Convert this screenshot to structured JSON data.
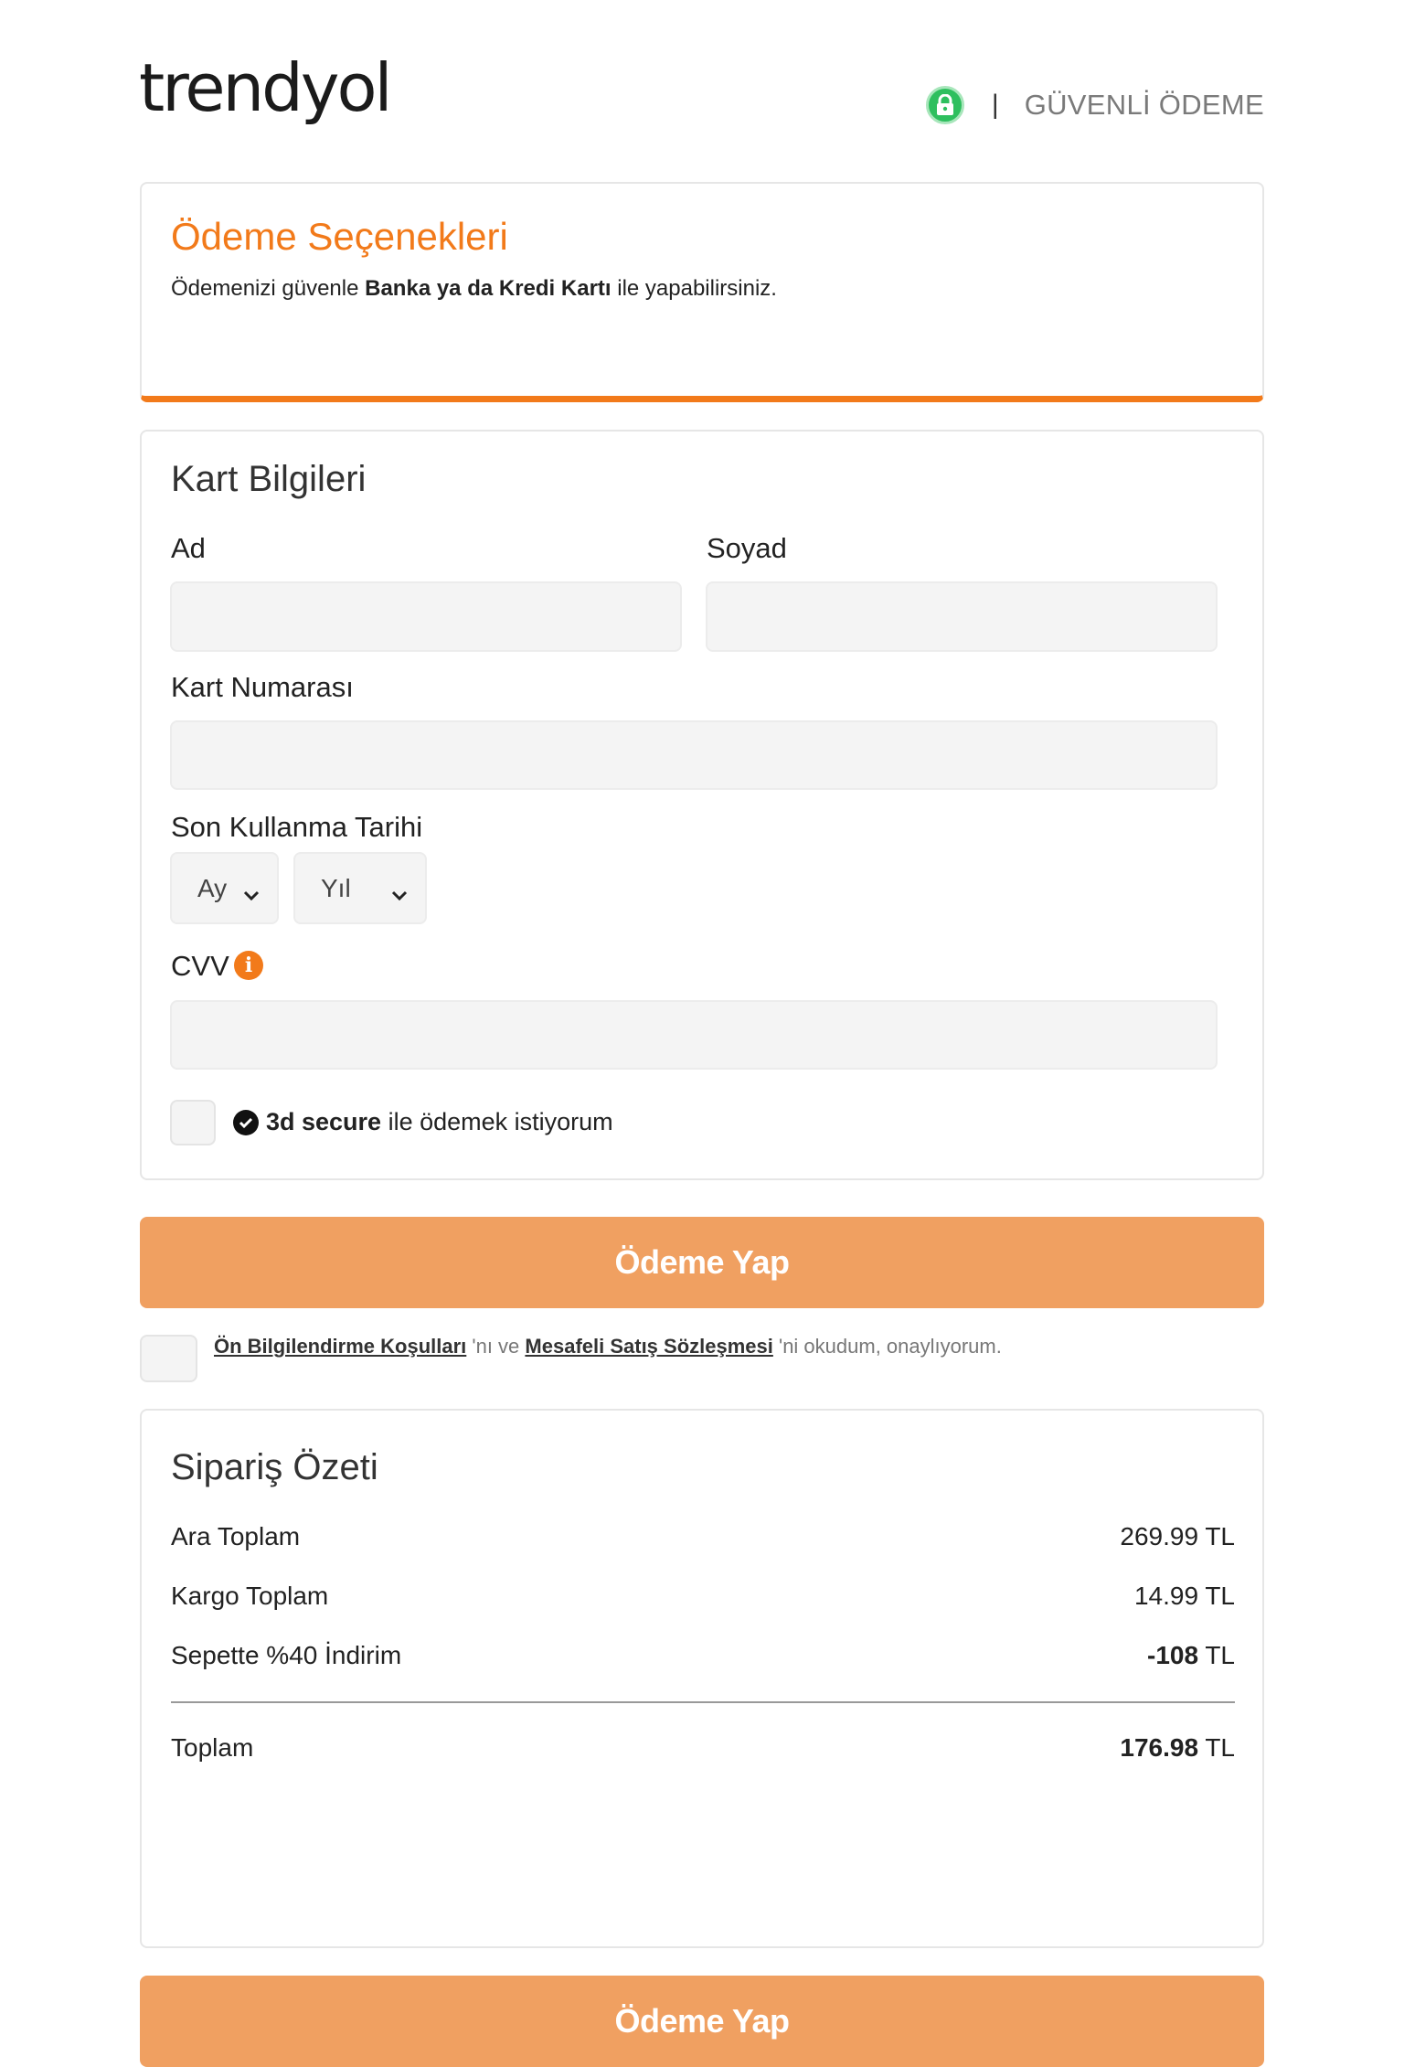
{
  "header": {
    "logo": "trendyol",
    "separator": "|",
    "secure_text": "GÜVENLİ ÖDEME"
  },
  "payment_options": {
    "title": "Ödeme Seçenekleri",
    "desc_prefix": "Ödemenizi güvenle ",
    "desc_bold": "Banka ya da Kredi Kartı",
    "desc_suffix": " ile yapabilirsiniz."
  },
  "card_info": {
    "title": "Kart Bilgileri",
    "first_name_label": "Ad",
    "last_name_label": "Soyad",
    "card_number_label": "Kart Numarası",
    "expiry_label": "Son Kullanma Tarihi",
    "month_select": "Ay",
    "year_select": "Yıl",
    "cvv_label": "CVV",
    "cvv_info": "i",
    "secure_bold": "3d secure",
    "secure_text": " ile ödemek istiyorum"
  },
  "pay_button": "Ödeme Yap",
  "agreement": {
    "link1": "Ön Bilgilendirme Koşulları",
    "mid": " 'nı ve ",
    "link2": "Mesafeli Satış Sözleşmesi",
    "suffix": " 'ni okudum, onaylıyorum."
  },
  "order_summary": {
    "title": "Sipariş Özeti",
    "rows": [
      {
        "label": "Ara Toplam",
        "value": "269.99",
        "currency": " TL"
      },
      {
        "label": "Kargo Toplam",
        "value": "14.99",
        "currency": " TL"
      },
      {
        "label": "Sepette %40 İndirim",
        "value": "-108",
        "currency": " TL"
      }
    ],
    "total_label": "Toplam",
    "total_value": "176.98",
    "total_currency": " TL"
  },
  "colors": {
    "brand": "#f27a1a",
    "button": "#f0a061",
    "secure_green": "#2ebf5e"
  }
}
